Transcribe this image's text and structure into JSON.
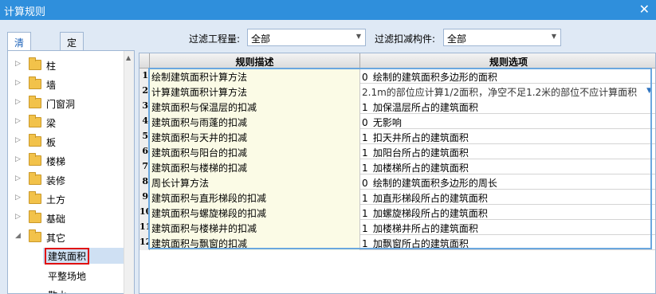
{
  "window": {
    "title": "计算规则",
    "close_icon": "close-icon"
  },
  "tabs": [
    {
      "label": "清单规则",
      "active": true
    },
    {
      "label": "定额规则",
      "active": false
    }
  ],
  "filters": {
    "quantity_label": "过滤工程量:",
    "quantity_value": "全部",
    "deduct_label": "过滤扣减构件:",
    "deduct_value": "全部"
  },
  "tree": {
    "items": [
      {
        "label": "柱"
      },
      {
        "label": "墙"
      },
      {
        "label": "门窗洞"
      },
      {
        "label": "梁"
      },
      {
        "label": "板"
      },
      {
        "label": "楼梯"
      },
      {
        "label": "装修"
      },
      {
        "label": "土方"
      },
      {
        "label": "基础"
      },
      {
        "label": "其它",
        "expanded": true
      }
    ],
    "children": [
      {
        "label": "建筑面积",
        "selected": true
      },
      {
        "label": "平整场地"
      },
      {
        "label": "散水"
      }
    ]
  },
  "grid": {
    "columns": [
      "规则描述",
      "规则选项"
    ],
    "rows": [
      {
        "num": "1",
        "desc": "绘制建筑面积计算方法",
        "value": "0",
        "option": "绘制的建筑面积多边形的面积"
      },
      {
        "num": "2",
        "desc": "计算建筑面积计算方法",
        "value": "",
        "option": "2.1m的部位应计算1/2面积，净空不足1.2米的部位不应计算面积"
      },
      {
        "num": "3",
        "desc": "建筑面积与保温层的扣减",
        "value": "1",
        "option": "加保温层所占的建筑面积"
      },
      {
        "num": "4",
        "desc": "建筑面积与雨蓬的扣减",
        "value": "0",
        "option": "无影响"
      },
      {
        "num": "5",
        "desc": "建筑面积与天井的扣减",
        "value": "1",
        "option": "扣天井所占的建筑面积"
      },
      {
        "num": "6",
        "desc": "建筑面积与阳台的扣减",
        "value": "1",
        "option": "加阳台所占的建筑面积"
      },
      {
        "num": "7",
        "desc": "建筑面积与楼梯的扣减",
        "value": "1",
        "option": "加楼梯所占的建筑面积"
      },
      {
        "num": "8",
        "desc": "周长计算方法",
        "value": "0",
        "option": "绘制的建筑面积多边形的周长"
      },
      {
        "num": "9",
        "desc": "建筑面积与直形梯段的扣减",
        "value": "1",
        "option": "加直形梯段所占的建筑面积"
      },
      {
        "num": "10",
        "desc": "建筑面积与螺旋梯段的扣减",
        "value": "1",
        "option": "加螺旋梯段所占的建筑面积"
      },
      {
        "num": "11",
        "desc": "建筑面积与楼梯井的扣减",
        "value": "1",
        "option": "加楼梯井所占的建筑面积"
      },
      {
        "num": "12",
        "desc": "建筑面积与飘窗的扣减",
        "value": "1",
        "option": "加飘窗所占的建筑面积"
      }
    ]
  },
  "colors": {
    "titlebar": "#2f8fdc",
    "panel": "#dfe9f5",
    "selection_outline": "#e01010",
    "desc_bg": "#fbfbe6",
    "frame": "#6aa7df"
  }
}
